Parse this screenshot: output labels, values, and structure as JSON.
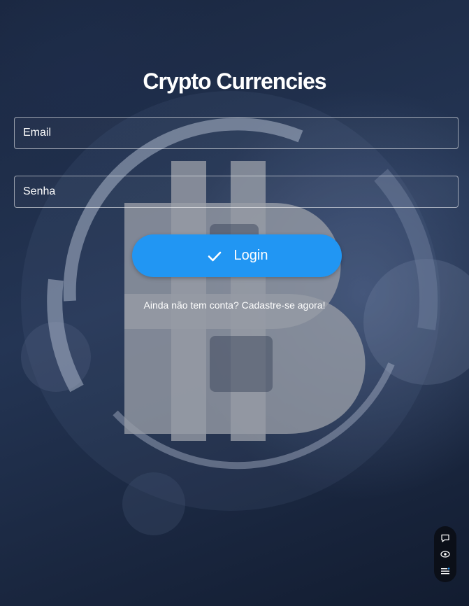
{
  "app": {
    "title": "Crypto Currencies"
  },
  "form": {
    "email_placeholder": "Email",
    "password_placeholder": "Senha",
    "login_label": "Login",
    "signup_text": "Ainda não tem conta? Cadastre-se agora!"
  },
  "colors": {
    "accent": "#2196f3",
    "background": "#1a2740"
  },
  "icons": {
    "login": "check-icon",
    "widget": [
      "chat-bubble-icon",
      "eye-icon",
      "menu-list-icon"
    ]
  }
}
